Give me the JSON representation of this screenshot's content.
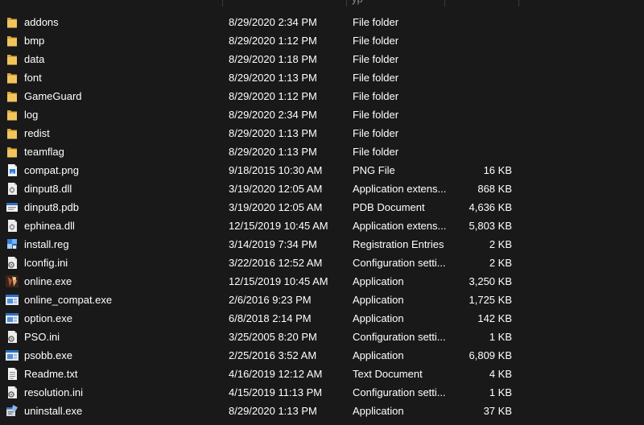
{
  "header": {
    "fragment": "yp"
  },
  "colors": {
    "background": "#191919",
    "text": "#ffffff",
    "folder": "#e8b84a"
  },
  "files": [
    {
      "name": "addons",
      "date": "8/29/2020 2:34 PM",
      "type": "File folder",
      "size": "",
      "icon": "folder-icon"
    },
    {
      "name": "bmp",
      "date": "8/29/2020 1:12 PM",
      "type": "File folder",
      "size": "",
      "icon": "folder-icon"
    },
    {
      "name": "data",
      "date": "8/29/2020 1:18 PM",
      "type": "File folder",
      "size": "",
      "icon": "folder-icon"
    },
    {
      "name": "font",
      "date": "8/29/2020 1:13 PM",
      "type": "File folder",
      "size": "",
      "icon": "folder-icon"
    },
    {
      "name": "GameGuard",
      "date": "8/29/2020 1:12 PM",
      "type": "File folder",
      "size": "",
      "icon": "folder-icon"
    },
    {
      "name": "log",
      "date": "8/29/2020 2:34 PM",
      "type": "File folder",
      "size": "",
      "icon": "folder-icon"
    },
    {
      "name": "redist",
      "date": "8/29/2020 1:13 PM",
      "type": "File folder",
      "size": "",
      "icon": "folder-icon"
    },
    {
      "name": "teamflag",
      "date": "8/29/2020 1:13 PM",
      "type": "File folder",
      "size": "",
      "icon": "folder-icon"
    },
    {
      "name": "compat.png",
      "date": "9/18/2015 10:30 AM",
      "type": "PNG File",
      "size": "16 KB",
      "icon": "png-file-icon"
    },
    {
      "name": "dinput8.dll",
      "date": "3/19/2020 12:05 AM",
      "type": "Application extens...",
      "size": "868 KB",
      "icon": "dll-file-icon"
    },
    {
      "name": "dinput8.pdb",
      "date": "3/19/2020 12:05 AM",
      "type": "PDB Document",
      "size": "4,636 KB",
      "icon": "pdb-file-icon"
    },
    {
      "name": "ephinea.dll",
      "date": "12/15/2019 10:45 AM",
      "type": "Application extens...",
      "size": "5,803 KB",
      "icon": "dll-file-icon"
    },
    {
      "name": "install.reg",
      "date": "3/14/2019 7:34 PM",
      "type": "Registration Entries",
      "size": "2 KB",
      "icon": "registry-file-icon"
    },
    {
      "name": "lconfig.ini",
      "date": "3/22/2016 12:52 AM",
      "type": "Configuration setti...",
      "size": "2 KB",
      "icon": "ini-file-icon"
    },
    {
      "name": "online.exe",
      "date": "12/15/2019 10:45 AM",
      "type": "Application",
      "size": "3,250 KB",
      "icon": "game-app-icon"
    },
    {
      "name": "online_compat.exe",
      "date": "2/6/2016 9:23 PM",
      "type": "Application",
      "size": "1,725 KB",
      "icon": "app-window-icon"
    },
    {
      "name": "option.exe",
      "date": "6/8/2018 2:14 PM",
      "type": "Application",
      "size": "142 KB",
      "icon": "app-window-icon"
    },
    {
      "name": "PSO.ini",
      "date": "3/25/2005 8:20 PM",
      "type": "Configuration setti...",
      "size": "1 KB",
      "icon": "ini-file-icon"
    },
    {
      "name": "psobb.exe",
      "date": "2/25/2016 3:52 AM",
      "type": "Application",
      "size": "6,809 KB",
      "icon": "app-window-icon"
    },
    {
      "name": "Readme.txt",
      "date": "4/16/2019 12:12 AM",
      "type": "Text Document",
      "size": "4 KB",
      "icon": "text-file-icon"
    },
    {
      "name": "resolution.ini",
      "date": "4/15/2019 11:13 PM",
      "type": "Configuration setti...",
      "size": "1 KB",
      "icon": "ini-file-icon"
    },
    {
      "name": "uninstall.exe",
      "date": "8/29/2020 1:13 PM",
      "type": "Application",
      "size": "37 KB",
      "icon": "uninstaller-icon"
    }
  ]
}
